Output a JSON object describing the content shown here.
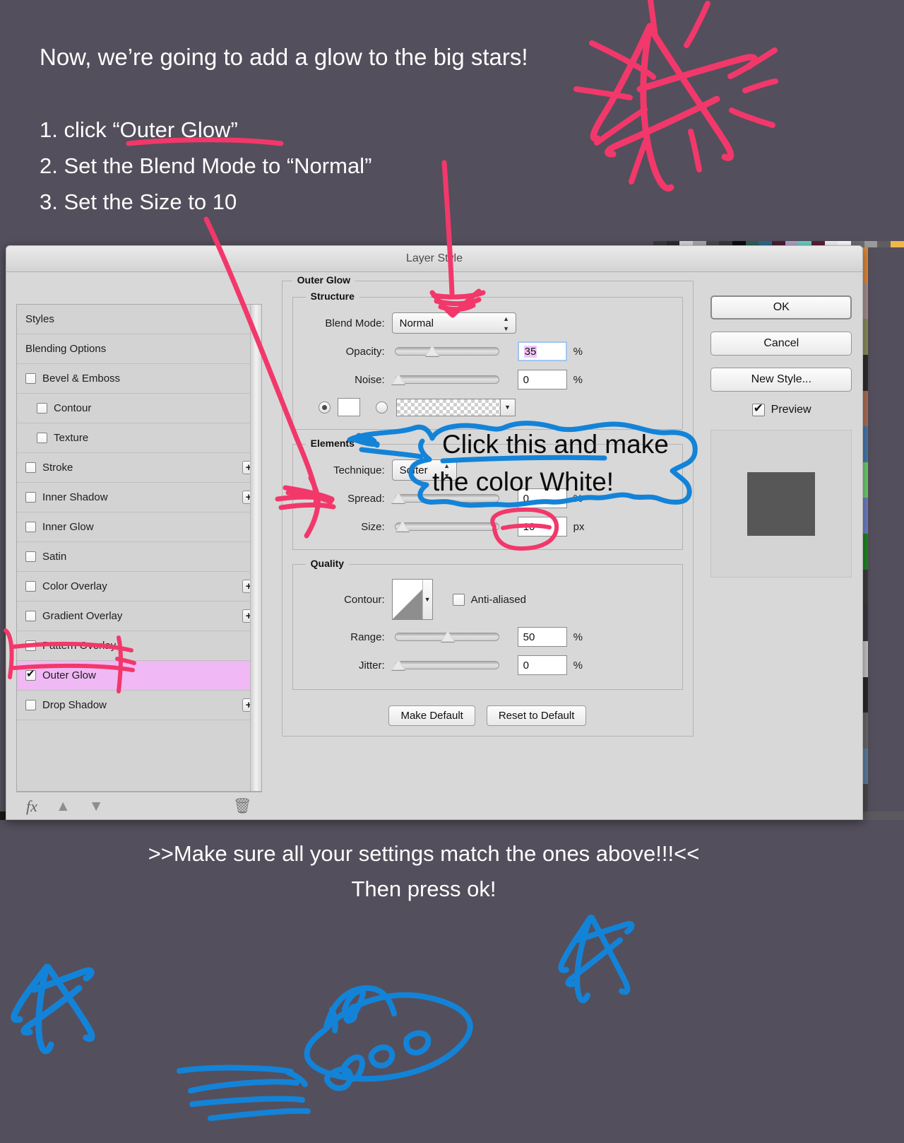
{
  "page": {
    "background_color": "#544f5c",
    "headline": "Now, we’re going to add a glow to the big stars!",
    "steps": [
      "1. click “Outer Glow”",
      "2. Set the Blend Mode to “Normal”",
      "3. Set the Size to 10"
    ],
    "footer_line1": ">>Make sure all your settings match the ones above!!!<<",
    "footer_line2": "Then press ok!"
  },
  "annotations": {
    "color_callout_line1": "Click this and make",
    "color_callout_line2": "the color White!",
    "pink_color": "#f2386b",
    "blue_color": "#1383d8"
  },
  "dialog": {
    "title": "Layer Style",
    "styles_list": [
      {
        "label": "Styles",
        "checkbox": false,
        "checked": false,
        "indent": false,
        "plus": false,
        "selected": false
      },
      {
        "label": "Blending Options",
        "checkbox": false,
        "checked": false,
        "indent": false,
        "plus": false,
        "selected": false
      },
      {
        "label": "Bevel & Emboss",
        "checkbox": true,
        "checked": false,
        "indent": false,
        "plus": false,
        "selected": false
      },
      {
        "label": "Contour",
        "checkbox": true,
        "checked": false,
        "indent": true,
        "plus": false,
        "selected": false
      },
      {
        "label": "Texture",
        "checkbox": true,
        "checked": false,
        "indent": true,
        "plus": false,
        "selected": false
      },
      {
        "label": "Stroke",
        "checkbox": true,
        "checked": false,
        "indent": false,
        "plus": true,
        "selected": false
      },
      {
        "label": "Inner Shadow",
        "checkbox": true,
        "checked": false,
        "indent": false,
        "plus": true,
        "selected": false
      },
      {
        "label": "Inner Glow",
        "checkbox": true,
        "checked": false,
        "indent": false,
        "plus": false,
        "selected": false
      },
      {
        "label": "Satin",
        "checkbox": true,
        "checked": false,
        "indent": false,
        "plus": false,
        "selected": false
      },
      {
        "label": "Color Overlay",
        "checkbox": true,
        "checked": false,
        "indent": false,
        "plus": true,
        "selected": false
      },
      {
        "label": "Gradient Overlay",
        "checkbox": true,
        "checked": false,
        "indent": false,
        "plus": true,
        "selected": false
      },
      {
        "label": "Pattern Overlay",
        "checkbox": true,
        "checked": false,
        "indent": false,
        "plus": false,
        "selected": false
      },
      {
        "label": "Outer Glow",
        "checkbox": true,
        "checked": true,
        "indent": false,
        "plus": false,
        "selected": true
      },
      {
        "label": "Drop Shadow",
        "checkbox": true,
        "checked": false,
        "indent": false,
        "plus": true,
        "selected": false
      }
    ],
    "list_toolbar": {
      "fx": "fx",
      "move_up": "▲",
      "move_down": "▼",
      "delete": "🗑"
    },
    "panel": {
      "section_title": "Outer Glow",
      "structure": {
        "legend": "Structure",
        "blend_mode_label": "Blend Mode:",
        "blend_mode_value": "Normal",
        "opacity_label": "Opacity:",
        "opacity_value": "35",
        "opacity_unit": "%",
        "noise_label": "Noise:",
        "noise_value": "0",
        "noise_unit": "%"
      },
      "elements": {
        "legend": "Elements",
        "technique_label": "Technique:",
        "technique_value": "Softer",
        "spread_label": "Spread:",
        "spread_value": "0",
        "spread_unit": "%",
        "size_label": "Size:",
        "size_value": "10",
        "size_unit": "px"
      },
      "quality": {
        "legend": "Quality",
        "contour_label": "Contour:",
        "antialiased_label": "Anti-aliased",
        "antialiased_checked": false,
        "range_label": "Range:",
        "range_value": "50",
        "range_unit": "%",
        "jitter_label": "Jitter:",
        "jitter_value": "0",
        "jitter_unit": "%"
      },
      "make_default_label": "Make Default",
      "reset_default_label": "Reset to Default"
    },
    "buttons": {
      "ok": "OK",
      "cancel": "Cancel",
      "new_style": "New Style...",
      "preview": "Preview",
      "preview_checked": true
    }
  },
  "background_swatches": {
    "top": [
      "#3b3a3d",
      "#2d2c31",
      "#d8d8d8",
      "#ababab",
      "#4a4a4f",
      "#3a3a3e",
      "#0c0c0c",
      "#2e6157",
      "#2d6c8c",
      "#4a1f33",
      "#b0a5c4",
      "#6ad0c3",
      "#5c1f36",
      "#f6f6f6",
      "#ffffff",
      "#6e6e6e",
      "#9a9a9a",
      "#5e5e5e",
      "#f0b84a"
    ],
    "right": [
      "#e08a3c",
      "#a89090",
      "#8c8f5a",
      "#2d2d2d",
      "#b07055",
      "#4a7ab0",
      "#6fd06f",
      "#6f80c8",
      "#1f8a1f",
      "#3d3d41",
      "#3a3a3e",
      "#c8c8c8",
      "#2a2a2c",
      "#6a6a6a",
      "#5e7fa0",
      "#4a4a4e"
    ]
  }
}
